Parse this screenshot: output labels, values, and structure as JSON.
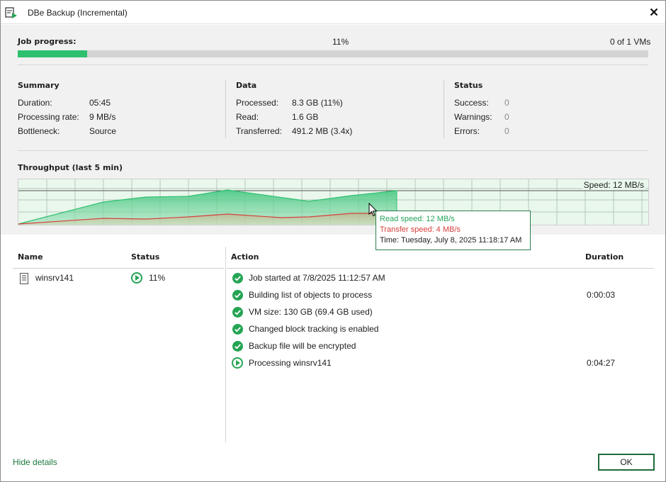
{
  "window": {
    "title": "DBe Backup (Incremental)"
  },
  "progress": {
    "label": "Job progress:",
    "percent_text": "11%",
    "percent": 11,
    "vms_text": "0 of 1 VMs"
  },
  "summary": {
    "title": "Summary",
    "rows": [
      {
        "key": "Duration:",
        "value": "05:45"
      },
      {
        "key": "Processing rate:",
        "value": "9 MB/s"
      },
      {
        "key": "Bottleneck:",
        "value": "Source"
      }
    ]
  },
  "data": {
    "title": "Data",
    "rows": [
      {
        "key": "Processed:",
        "value": "8.3 GB (11%)"
      },
      {
        "key": "Read:",
        "value": "1.6 GB"
      },
      {
        "key": "Transferred:",
        "value": "491.2 MB (3.4x)"
      }
    ]
  },
  "status": {
    "title": "Status",
    "rows": [
      {
        "key": "Success:",
        "value": "0"
      },
      {
        "key": "Warnings:",
        "value": "0"
      },
      {
        "key": "Errors:",
        "value": "0"
      }
    ]
  },
  "throughput": {
    "title": "Throughput (last 5 min)",
    "speed_label": "Speed: 12 MB/s",
    "tooltip": {
      "read": "Read speed: 12 MB/s",
      "transfer": "Transfer speed: 4 MB/s",
      "time": "Time: Tuesday, July 8, 2025 11:18:17 AM"
    },
    "colors": {
      "read": "#2ec06f",
      "transfer": "#d6403e"
    }
  },
  "table": {
    "headers": {
      "name": "Name",
      "status": "Status",
      "action": "Action",
      "duration": "Duration"
    },
    "vms": [
      {
        "name": "winsrv141",
        "status": "11%"
      }
    ],
    "actions": [
      {
        "text": "Job started at 7/8/2025 11:12:57 AM",
        "duration": "",
        "icon": "check-icon"
      },
      {
        "text": "Building list of objects to process",
        "duration": "0:00:03",
        "icon": "check-icon"
      },
      {
        "text": "VM size: 130 GB (69.4 GB used)",
        "duration": "",
        "icon": "check-icon"
      },
      {
        "text": "Changed block tracking is enabled",
        "duration": "",
        "icon": "check-icon"
      },
      {
        "text": "Backup file will be encrypted",
        "duration": "",
        "icon": "check-icon"
      },
      {
        "text": "Processing winsrv141",
        "duration": "0:04:27",
        "icon": "play-icon"
      }
    ]
  },
  "footer": {
    "hide_details": "Hide details",
    "ok": "OK"
  }
}
